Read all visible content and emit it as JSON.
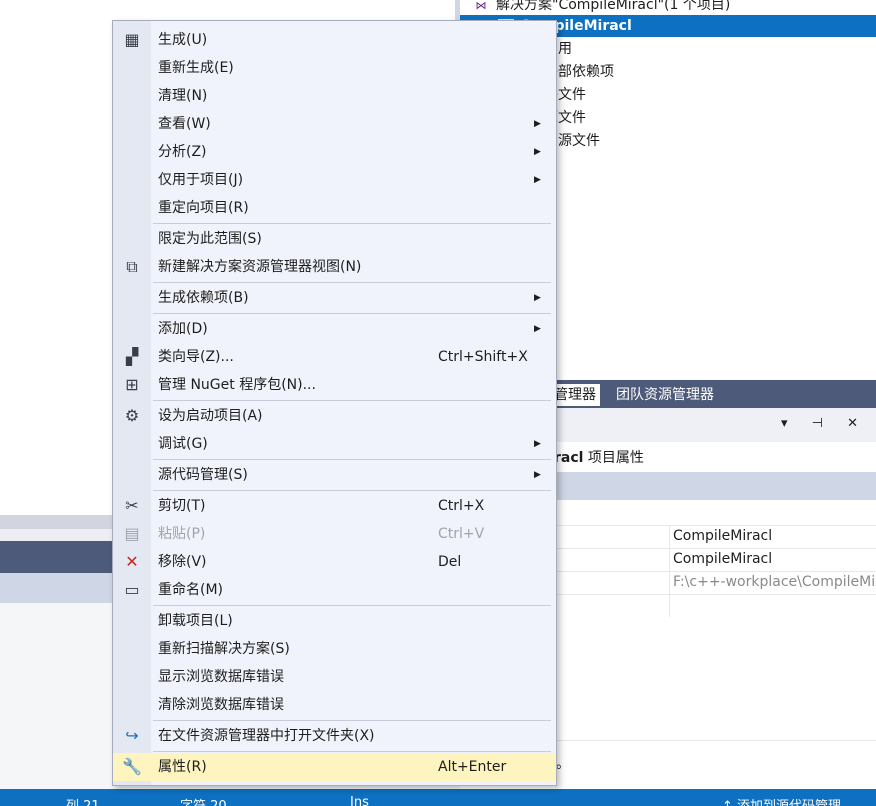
{
  "solution_explorer": {
    "solution_label": "解决方案\"CompileMiracl\"(1 个项目)",
    "project_label": "CompileMiracl",
    "items": [
      "引用",
      "外部依赖项",
      "头文件",
      "源文件",
      "资源文件"
    ]
  },
  "panel_tabs": {
    "solution_explorer": "管理器",
    "team_explorer": "团队资源管理器"
  },
  "properties": {
    "pin_icons": "▾ ⊣ ✕",
    "header_bold": "racl",
    "header_suffix": " 项目属性",
    "rows": [
      "CompileMiracl",
      "CompileMiracl",
      "F:\\c++-workplace\\CompileMiracl",
      ""
    ],
    "description_tail": "。"
  },
  "statusbar": {
    "col": "列 21",
    "char": "字符 20",
    "ins": "Ins",
    "source_control": "↑ 添加到源代码管理"
  },
  "context_menu": {
    "items": [
      {
        "label": "生成(U)",
        "icon": "build-icon",
        "glyph": "▦"
      },
      {
        "label": "重新生成(E)"
      },
      {
        "label": "清理(N)"
      },
      {
        "label": "查看(W)",
        "submenu": "▶"
      },
      {
        "label": "分析(Z)",
        "submenu": "▶"
      },
      {
        "label": "仅用于项目(J)",
        "submenu": "▶"
      },
      {
        "label": "重定向项目(R)"
      },
      {
        "label": "限定为此范围(S)"
      },
      {
        "label": "新建解决方案资源管理器视图(N)",
        "icon": "new-view-icon",
        "glyph": "⧉"
      },
      {
        "label": "生成依赖项(B)",
        "submenu": "▶"
      },
      {
        "label": "添加(D)",
        "submenu": "▶"
      },
      {
        "label": "类向导(Z)...",
        "shortcut": "Ctrl+Shift+X",
        "icon": "class-wizard-icon",
        "glyph": "▞"
      },
      {
        "label": "管理 NuGet 程序包(N)...",
        "icon": "nuget-package-icon",
        "glyph": "⊞"
      },
      {
        "label": "设为启动项目(A)",
        "icon": "gear-icon",
        "glyph": "⚙"
      },
      {
        "label": "调试(G)",
        "submenu": "▶"
      },
      {
        "label": "源代码管理(S)",
        "submenu": "▶"
      },
      {
        "label": "剪切(T)",
        "shortcut": "Ctrl+X",
        "icon": "scissors-icon",
        "glyph": "✂"
      },
      {
        "label": "粘贴(P)",
        "shortcut": "Ctrl+V",
        "icon": "paste-icon",
        "glyph": "▤",
        "disabled": true
      },
      {
        "label": "移除(V)",
        "shortcut": "Del",
        "icon": "remove-icon",
        "glyph": "✕",
        "color": "#c42b1c"
      },
      {
        "label": "重命名(M)",
        "icon": "rename-icon",
        "glyph": "▭"
      },
      {
        "label": "卸载项目(L)"
      },
      {
        "label": "重新扫描解决方案(S)"
      },
      {
        "label": "显示浏览数据库错误"
      },
      {
        "label": "清除浏览数据库错误"
      },
      {
        "label": "在文件资源管理器中打开文件夹(X)",
        "icon": "open-folder-icon",
        "glyph": "↪",
        "color": "#1e6fc0"
      },
      {
        "label": "属性(R)",
        "shortcut": "Alt+Enter",
        "icon": "wrench-icon",
        "glyph": "🔧"
      }
    ]
  }
}
